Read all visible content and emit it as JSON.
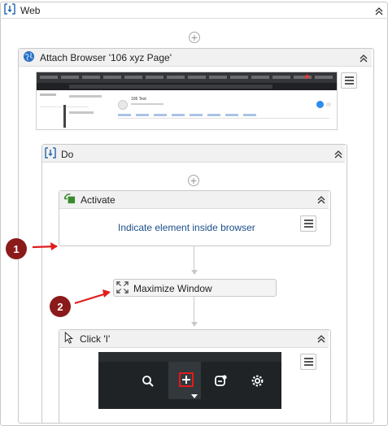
{
  "web": {
    "title": "Web"
  },
  "attach": {
    "title": "Attach Browser '106 xyz Page'",
    "preview_heading": "106 Test"
  },
  "do_block": {
    "title": "Do"
  },
  "activate": {
    "title": "Activate",
    "link_text": "Indicate element inside browser"
  },
  "maximize": {
    "title": "Maximize Window"
  },
  "click": {
    "title": "Click 'I'"
  },
  "callouts": [
    {
      "label": "1"
    },
    {
      "label": "2"
    }
  ],
  "colors": {
    "callout": "#8b1a1a",
    "arrow": "#e11d1d",
    "link": "#1a4f8a",
    "dark_toolbar": "#1f2326"
  }
}
